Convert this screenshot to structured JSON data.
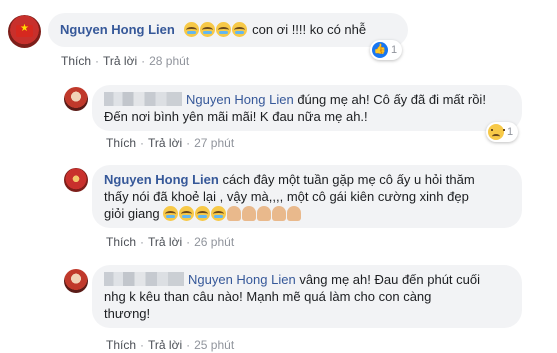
{
  "comments": [
    {
      "author": "Nguyen Hong Lien",
      "text": "con ơi !!!! ko có nhễ",
      "like": "Thích",
      "reply": "Trả lời",
      "time": "28 phút",
      "reaction_count": "1",
      "reaction_icon": "like-icon"
    },
    {
      "author": "Nguyen Hong Lien",
      "text_line1": "đúng mẹ ah! Cô ấy đã đi mất rồi!",
      "text_line2": "Đến nơi bình yên mãi mãi! K đau nữa mẹ ah.!",
      "like": "Thích",
      "reply": "Trả lời",
      "time": "27 phút",
      "reaction_count": "1",
      "reaction_icon": "sad-icon"
    },
    {
      "author": "Nguyen Hong Lien",
      "text_line1": "cách đây một tuần gặp mẹ cô ấy u hỏi thăm",
      "text_line2": "thấy nói đã khoẻ lại , vậy mà,,,, một cô gái kiên cường xinh đẹp",
      "text_line3": "giỏi giang",
      "like": "Thích",
      "reply": "Trả lời",
      "time": "26 phút"
    },
    {
      "author": "Nguyen Hong Lien",
      "text_line1": "vâng mẹ ah! Đau đến phút cuối",
      "text_line2": "nhg k kêu than câu nào! Mạnh mẽ quá làm cho con càng",
      "text_line3": "thương!",
      "like": "Thích",
      "reply": "Trả lời",
      "time": "25 phút"
    }
  ]
}
